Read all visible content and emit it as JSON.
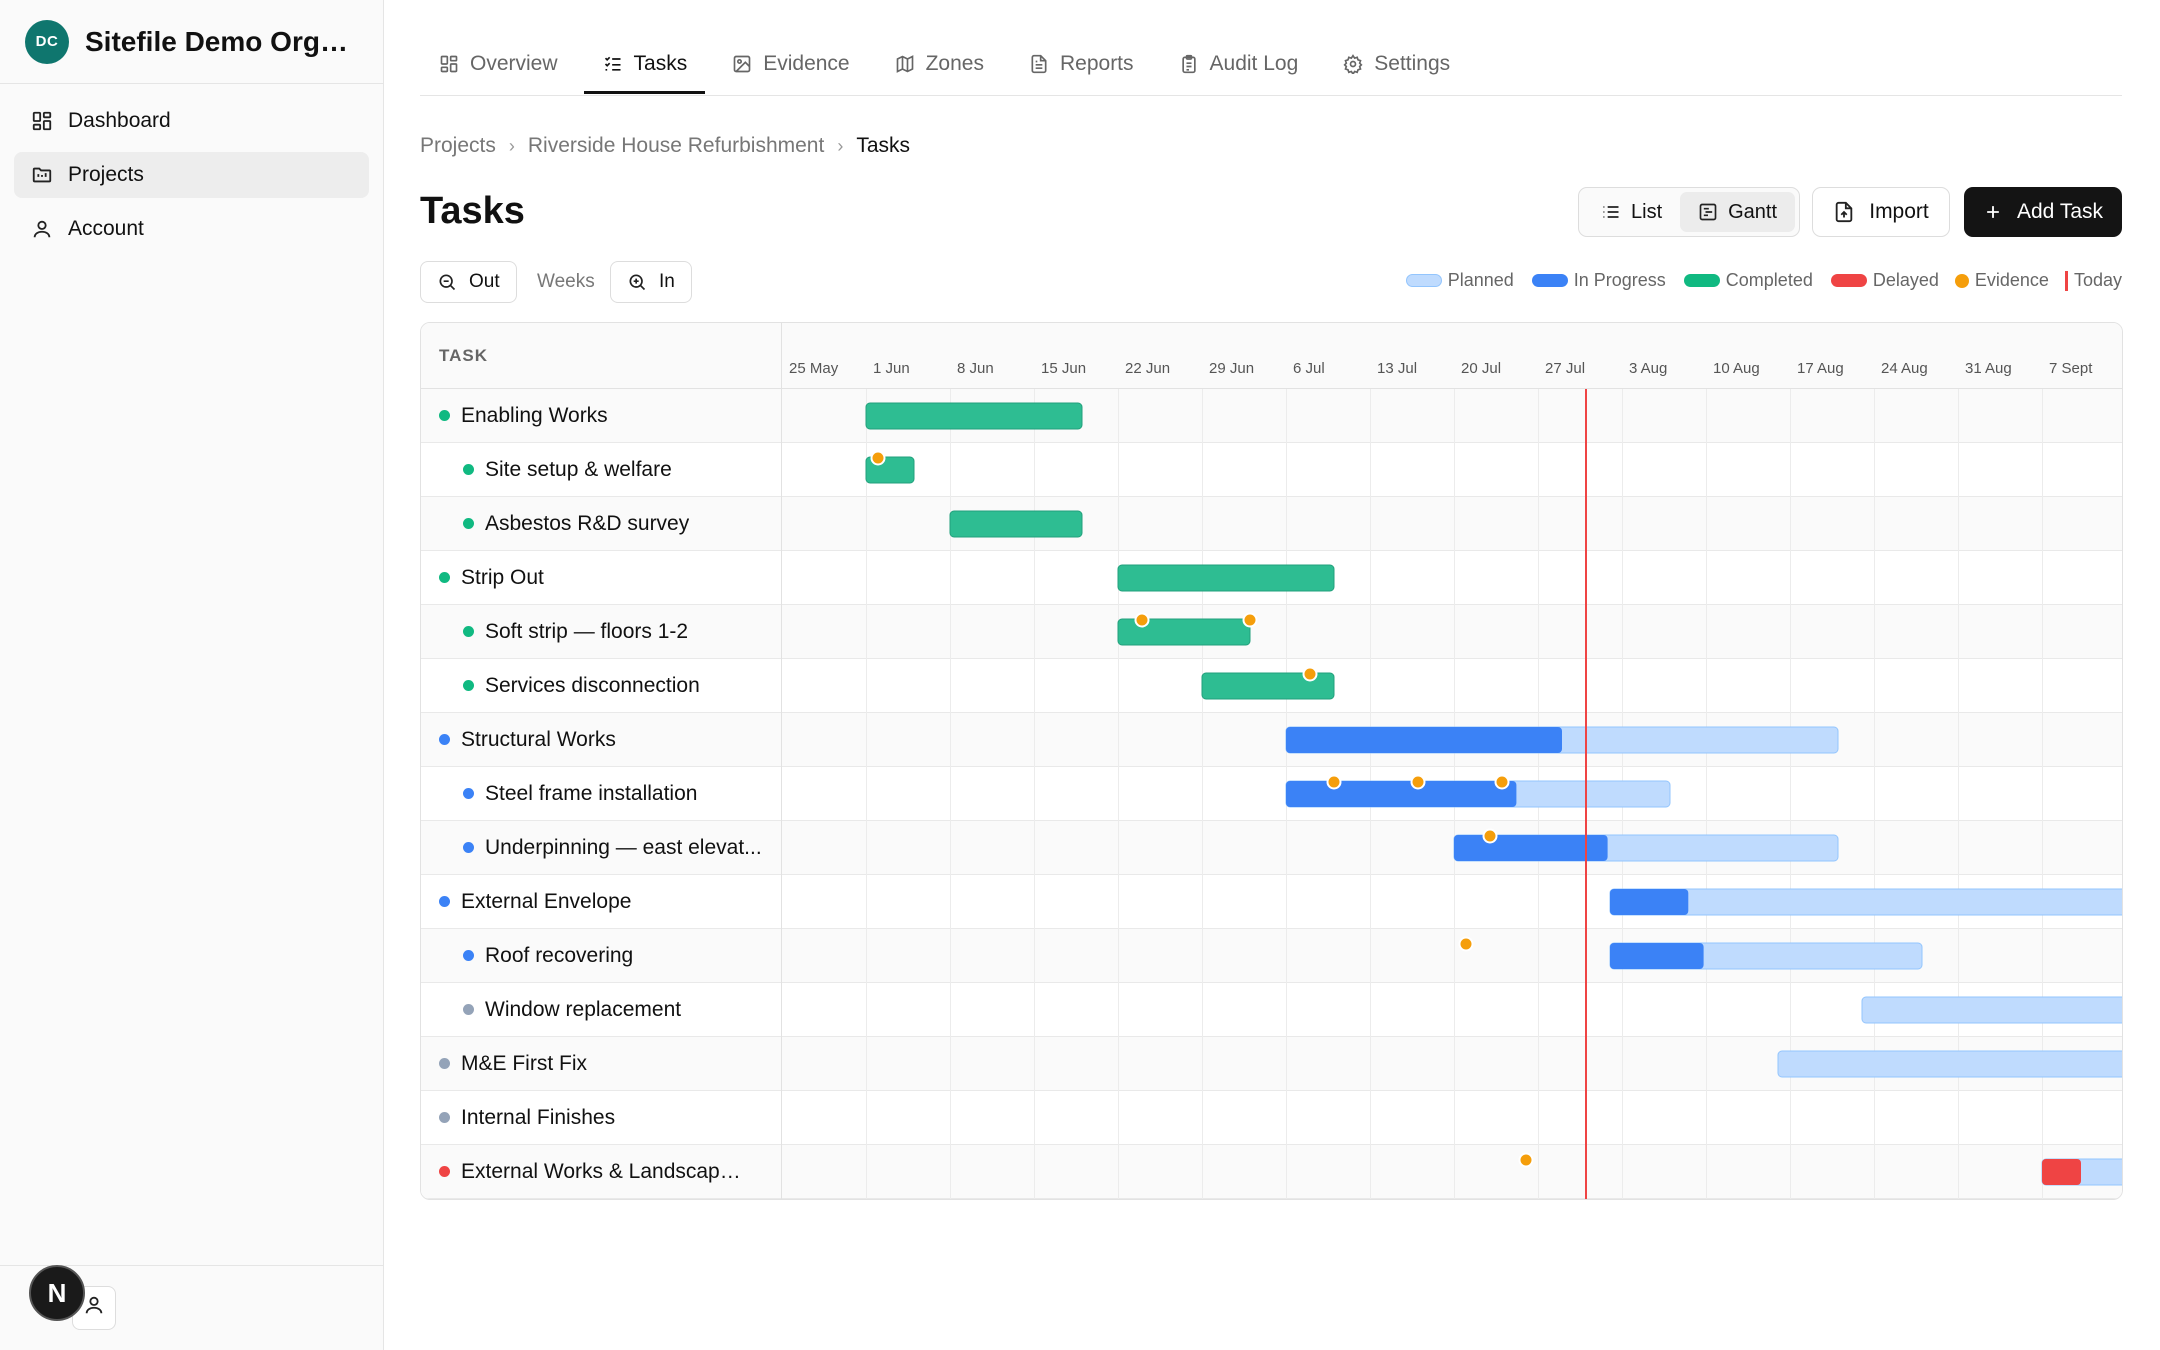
{
  "org": {
    "initials": "DC",
    "name": "Sitefile Demo Orga..."
  },
  "sidebar": {
    "items": [
      {
        "label": "Dashboard",
        "icon": "dashboard-icon"
      },
      {
        "label": "Projects",
        "icon": "folder-icon",
        "active": true
      },
      {
        "label": "Account",
        "icon": "user-icon"
      }
    ],
    "badge": "N"
  },
  "tabs": [
    {
      "label": "Overview",
      "icon": "grid-icon"
    },
    {
      "label": "Tasks",
      "icon": "list-checks-icon",
      "active": true
    },
    {
      "label": "Evidence",
      "icon": "image-icon"
    },
    {
      "label": "Zones",
      "icon": "map-icon"
    },
    {
      "label": "Reports",
      "icon": "document-icon"
    },
    {
      "label": "Audit Log",
      "icon": "clipboard-icon"
    },
    {
      "label": "Settings",
      "icon": "gear-icon"
    }
  ],
  "breadcrumb": {
    "root": "Projects",
    "project": "Riverside House Refurbishment",
    "current": "Tasks"
  },
  "page": {
    "title": "Tasks"
  },
  "header_buttons": {
    "list": "List",
    "gantt": "Gantt",
    "import": "Import",
    "add": "Add Task"
  },
  "zoom": {
    "out": "Out",
    "scale": "Weeks",
    "in": "In"
  },
  "legend": {
    "planned": "Planned",
    "in_progress": "In Progress",
    "completed": "Completed",
    "delayed": "Delayed",
    "evidence": "Evidence",
    "today": "Today"
  },
  "colors": {
    "planned": "#bfdbfe",
    "in_progress": "#3b82f6",
    "completed": "#10b981",
    "completed_bar": "#2ebd92",
    "delayed": "#ef4444",
    "evidence": "#f59e0b",
    "today": "#ef4444",
    "not_started": "#94a3b8"
  },
  "gantt": {
    "column_header": "TASK",
    "weeks": [
      "25 May",
      "1 Jun",
      "8 Jun",
      "15 Jun",
      "22 Jun",
      "29 Jun",
      "6 Jul",
      "13 Jul",
      "20 Jul",
      "27 Jul",
      "3 Aug",
      "10 Aug",
      "17 Aug",
      "24 Aug",
      "31 Aug",
      "7 Sept"
    ],
    "timeline_start": "2025-05-25",
    "today": "2025-07-31",
    "tasks": [
      {
        "name": "Enabling Works",
        "level": 0,
        "status": "completed",
        "start": "2025-06-01",
        "end": "2025-06-19",
        "progress": 1.0,
        "evidence": []
      },
      {
        "name": "Site setup & welfare",
        "level": 1,
        "status": "completed",
        "start": "2025-06-01",
        "end": "2025-06-05",
        "progress": 1.0,
        "evidence": [
          "2025-06-02"
        ]
      },
      {
        "name": "Asbestos R&D survey",
        "level": 1,
        "status": "completed",
        "start": "2025-06-08",
        "end": "2025-06-19",
        "progress": 1.0,
        "evidence": []
      },
      {
        "name": "Strip Out",
        "level": 0,
        "status": "completed",
        "start": "2025-06-22",
        "end": "2025-07-10",
        "progress": 1.0,
        "evidence": []
      },
      {
        "name": "Soft strip — floors 1-2",
        "level": 1,
        "status": "completed",
        "start": "2025-06-22",
        "end": "2025-07-03",
        "progress": 1.0,
        "evidence": [
          "2025-06-24",
          "2025-07-03"
        ]
      },
      {
        "name": "Services disconnection",
        "level": 1,
        "status": "completed",
        "start": "2025-06-29",
        "end": "2025-07-10",
        "progress": 1.0,
        "evidence": [
          "2025-07-08"
        ]
      },
      {
        "name": "Structural Works",
        "level": 0,
        "status": "in_progress",
        "start": "2025-07-06",
        "end": "2025-08-21",
        "progress": 0.5,
        "evidence": []
      },
      {
        "name": "Steel frame installation",
        "level": 1,
        "status": "in_progress",
        "start": "2025-07-06",
        "end": "2025-08-07",
        "progress": 0.6,
        "evidence": [
          "2025-07-10",
          "2025-07-17",
          "2025-07-24"
        ]
      },
      {
        "name": "Underpinning — east elevat...",
        "level": 1,
        "status": "in_progress",
        "start": "2025-07-20",
        "end": "2025-08-21",
        "progress": 0.4,
        "evidence": [
          "2025-07-23"
        ]
      },
      {
        "name": "External Envelope",
        "level": 0,
        "status": "in_progress",
        "start": "2025-08-02",
        "end": "2025-09-21",
        "progress": 0.15,
        "evidence": []
      },
      {
        "name": "Roof recovering",
        "level": 1,
        "status": "in_progress",
        "start": "2025-08-02",
        "end": "2025-08-28",
        "progress": 0.3,
        "evidence": [
          "2025-07-21"
        ]
      },
      {
        "name": "Window replacement",
        "level": 1,
        "status": "planned",
        "start": "2025-08-23",
        "end": "2025-09-21",
        "progress": 0,
        "evidence": []
      },
      {
        "name": "M&E First Fix",
        "level": 0,
        "status": "planned",
        "start": "2025-08-16",
        "end": "2025-09-21",
        "progress": 0,
        "evidence": []
      },
      {
        "name": "Internal Finishes",
        "level": 0,
        "status": "not_started",
        "start": null,
        "end": null,
        "progress": 0,
        "evidence": []
      },
      {
        "name": "External Works & Landscaping",
        "level": 0,
        "status": "delayed",
        "start": "2025-09-07",
        "end": "2025-09-21",
        "progress": 0.3,
        "evidence": [
          "2025-07-26"
        ]
      }
    ]
  }
}
